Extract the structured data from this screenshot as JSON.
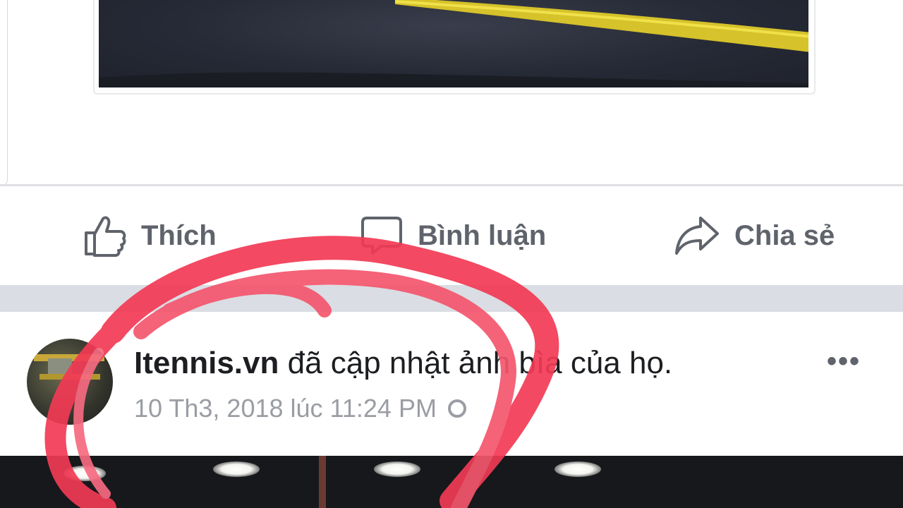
{
  "actions": {
    "like_label": "Thích",
    "comment_label": "Bình luận",
    "share_label": "Chia sẻ"
  },
  "post": {
    "page_name": "Itennis.vn",
    "action_text": " đã cập nhật ảnh bìa của họ.",
    "timestamp": "10 Th3, 2018 lúc 11:24 PM",
    "more_label": "•••"
  },
  "colors": {
    "action_text": "#5f636b",
    "timestamp": "#9a9da3",
    "separator": "#dadde3",
    "highlight_scribble": "#f23a55"
  },
  "icons": {
    "like": "thumbs-up-icon",
    "comment": "comment-bubble-icon",
    "share": "share-arrow-icon",
    "privacy": "globe-icon",
    "more": "more-dots-icon"
  }
}
